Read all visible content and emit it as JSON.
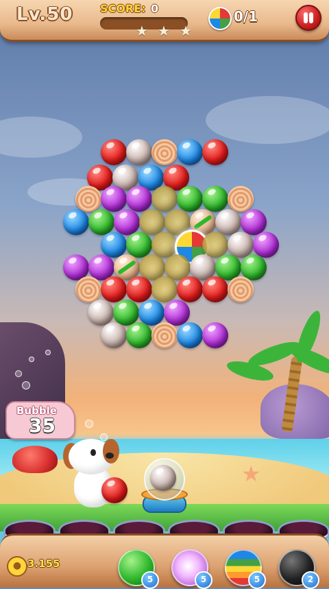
{
  "hud": {
    "level": "Lv.50",
    "score_label": "SCORE:",
    "score_value": "0",
    "score_progress": 0,
    "target_count": "0/1",
    "pause_icon": "pause-icon"
  },
  "board": {
    "rows": [
      [
        "red",
        "silver",
        "shell",
        "blue",
        "red"
      ],
      [
        "red",
        "silver",
        "blue",
        "red"
      ],
      [
        "shell",
        "purple",
        "purple",
        "gold",
        "green",
        "green",
        "shell"
      ],
      [
        "blue",
        "green",
        "purple",
        "gold",
        "gold",
        "ribbon",
        "silver",
        "purple"
      ],
      [
        "blue",
        "green",
        "gold",
        "core",
        "gold",
        "silver",
        "purple"
      ],
      [
        "purple",
        "purple",
        "ribbon",
        "gold",
        "gold",
        "silver",
        "green",
        "green"
      ],
      [
        "shell",
        "red",
        "red",
        "gold",
        "red",
        "red",
        "shell"
      ],
      [
        "silver",
        "green",
        "blue",
        "purple"
      ],
      [
        "silver",
        "green",
        "shell",
        "blue",
        "purple"
      ]
    ]
  },
  "side": {
    "sign_label": "Bubble",
    "bubble_count": "35"
  },
  "launcher": {
    "loaded_bubble": "silver",
    "next_bubble": "red"
  },
  "bottom": {
    "coins": "3.155",
    "paw_icon": "paw-icon",
    "boosters": [
      {
        "name": "aim-line-booster",
        "count": "5",
        "color": "#2fb72c"
      },
      {
        "name": "lightning-ball-booster",
        "count": "5",
        "color": "#e07aff"
      },
      {
        "name": "rainbow-ball-booster",
        "count": "5",
        "color": "#ff9a2e"
      },
      {
        "name": "bomb-ball-booster",
        "count": "2",
        "color": "#222222"
      }
    ]
  }
}
